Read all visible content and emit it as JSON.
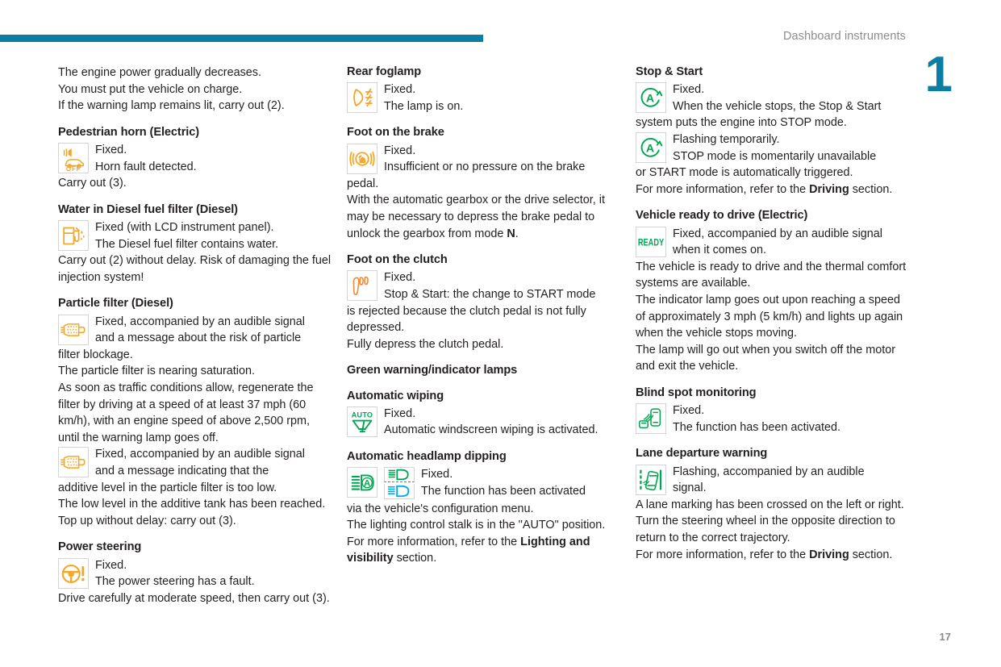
{
  "header": {
    "title": "Dashboard instruments",
    "chapter": "1",
    "page_number": "17",
    "rule_color": "#0b7ea3"
  },
  "colors": {
    "amber": "#F5A623",
    "orange": "#F08A3C",
    "green": "#00A651",
    "blue": "#00AEEF",
    "accent": "#0b7ea3",
    "grey_text": "#8a8c8f"
  },
  "columns": [
    {
      "id": "column-1",
      "blocks": [
        {
          "kind": "text",
          "name": "engine-power-line-1",
          "text": "The engine power gradually decreases."
        },
        {
          "kind": "text",
          "name": "engine-power-line-2",
          "text": "You must put the vehicle on charge."
        },
        {
          "kind": "text",
          "name": "engine-power-line-3",
          "text": "If the warning lamp remains lit, carry out (2)."
        },
        {
          "kind": "heading",
          "name": "heading-pedestrian-horn",
          "text": "Pedestrian horn (Electric)"
        },
        {
          "kind": "icon",
          "name": "icon-pedestrian-horn",
          "icon": "pedestrian-horn-off-icon",
          "lines": [
            "Fixed.",
            "Horn fault detected."
          ]
        },
        {
          "kind": "text",
          "name": "pedestrian-horn-followup",
          "text": "Carry out (3)."
        },
        {
          "kind": "heading",
          "name": "heading-water-in-diesel-fuel-filter",
          "text": "Water in Diesel fuel filter (Diesel)"
        },
        {
          "kind": "icon",
          "name": "icon-water-in-diesel-fuel-filter",
          "icon": "fuel-filter-water-icon",
          "lines": [
            "Fixed (with LCD instrument panel).",
            "The Diesel fuel filter contains water."
          ]
        },
        {
          "kind": "text",
          "name": "water-in-fuel-filter-followup",
          "text": "Carry out (2) without delay. Risk of damaging the fuel injection system!"
        },
        {
          "kind": "heading",
          "name": "heading-particle-filter",
          "text": "Particle filter (Diesel)"
        },
        {
          "kind": "icon",
          "name": "icon-particle-filter-blockage",
          "icon": "particle-filter-icon",
          "lines": [
            "Fixed, accompanied by an audible signal",
            "and a message about the risk of particle"
          ]
        },
        {
          "kind": "text",
          "name": "particle-filter-blockage-followup",
          "text": "filter blockage."
        },
        {
          "kind": "text",
          "name": "particle-filter-saturation",
          "text": "The particle filter is nearing saturation."
        },
        {
          "kind": "text",
          "name": "particle-filter-regeneration",
          "text": "As soon as traffic conditions allow, regenerate the filter by driving at a speed of at least 37 mph (60 km/h), with an engine speed of above 2,500 rpm, until the warning lamp goes off."
        },
        {
          "kind": "icon",
          "name": "icon-particle-filter-additive",
          "icon": "particle-filter-icon",
          "lines": [
            "Fixed, accompanied by an audible signal",
            "and a message indicating that the"
          ]
        },
        {
          "kind": "text",
          "name": "particle-filter-additive-followup",
          "text": "additive level in the particle filter is too low."
        },
        {
          "kind": "text",
          "name": "additive-tank-low",
          "text": "The low level in the additive tank has been reached."
        },
        {
          "kind": "text",
          "name": "additive-top-up",
          "text": "Top up without delay: carry out (3)."
        },
        {
          "kind": "heading",
          "name": "heading-power-steering",
          "text": "Power steering"
        },
        {
          "kind": "icon",
          "name": "icon-power-steering",
          "icon": "power-steering-icon",
          "lines": [
            "Fixed.",
            "The power steering has a fault."
          ]
        },
        {
          "kind": "text",
          "name": "power-steering-followup",
          "text": "Drive carefully at moderate speed, then carry out (3)."
        }
      ]
    },
    {
      "id": "column-2",
      "blocks": [
        {
          "kind": "heading",
          "name": "heading-rear-foglamp",
          "text": "Rear foglamp"
        },
        {
          "kind": "icon",
          "name": "icon-rear-foglamp",
          "icon": "rear-foglamp-icon",
          "lines": [
            "Fixed.",
            "The lamp is on."
          ]
        },
        {
          "kind": "heading",
          "name": "heading-foot-on-the-brake",
          "text": "Foot on the brake"
        },
        {
          "kind": "icon",
          "name": "icon-foot-on-the-brake",
          "icon": "foot-on-brake-icon",
          "lines": [
            "Fixed.",
            "Insufficient or no pressure on the brake"
          ]
        },
        {
          "kind": "text",
          "name": "foot-on-brake-followup",
          "text": "pedal."
        },
        {
          "kind": "rich",
          "name": "foot-on-brake-gearbox-note",
          "html": "With the automatic gearbox or the drive selector, it may be necessary to depress the brake pedal to unlock the gearbox from mode <b>N</b>."
        },
        {
          "kind": "heading",
          "name": "heading-foot-on-the-clutch",
          "text": "Foot on the clutch"
        },
        {
          "kind": "icon",
          "name": "icon-foot-on-the-clutch",
          "icon": "foot-on-clutch-icon",
          "lines": [
            "Fixed.",
            "Stop & Start: the change to START mode"
          ]
        },
        {
          "kind": "text",
          "name": "foot-on-clutch-followup",
          "text": "is rejected because the clutch pedal is not fully depressed."
        },
        {
          "kind": "text",
          "name": "foot-on-clutch-action",
          "text": "Fully depress the clutch pedal."
        },
        {
          "kind": "heading",
          "name": "heading-green-warning-lamps",
          "text": "Green warning/indicator lamps"
        },
        {
          "kind": "heading",
          "name": "heading-automatic-wiping",
          "text": "Automatic wiping"
        },
        {
          "kind": "icon",
          "name": "icon-automatic-wiping",
          "icon": "automatic-wiping-icon",
          "lines": [
            "Fixed.",
            "Automatic windscreen wiping is activated."
          ]
        },
        {
          "kind": "heading",
          "name": "heading-automatic-headlamp-dipping",
          "text": "Automatic headlamp dipping"
        },
        {
          "kind": "dualicon",
          "name": "icon-automatic-headlamp-dipping",
          "icon_left": "auto-headlamp-a-icon",
          "icon_right_top": "main-beam-green-icon",
          "icon_right_bottom": "dipped-beam-blue-icon",
          "lines": [
            "Fixed.",
            "The function has been activated"
          ]
        },
        {
          "kind": "text",
          "name": "auto-headlamp-followup",
          "text": "via the vehicle's configuration menu."
        },
        {
          "kind": "text",
          "name": "auto-headlamp-stalk",
          "text": "The lighting control stalk is in the \"AUTO\" position."
        },
        {
          "kind": "rich",
          "name": "auto-headlamp-more-info",
          "html": "For more information, refer to the <b>Lighting and visibility</b> section."
        }
      ]
    },
    {
      "id": "column-3",
      "blocks": [
        {
          "kind": "heading",
          "name": "heading-stop-and-start",
          "text": "Stop & Start"
        },
        {
          "kind": "icon",
          "name": "icon-stop-start-fixed",
          "icon": "stop-start-a-icon",
          "lines": [
            "Fixed.",
            "When the vehicle stops, the Stop & Start"
          ]
        },
        {
          "kind": "text",
          "name": "stop-start-fixed-followup",
          "text": "system puts the engine into STOP mode."
        },
        {
          "kind": "icon",
          "name": "icon-stop-start-flashing",
          "icon": "stop-start-a-icon",
          "lines": [
            "Flashing temporarily.",
            "STOP mode is momentarily unavailable"
          ]
        },
        {
          "kind": "text",
          "name": "stop-start-flashing-followup",
          "text": "or START mode is automatically triggered."
        },
        {
          "kind": "rich",
          "name": "stop-start-more-info",
          "html": "For more information, refer to the <b>Driving</b> section."
        },
        {
          "kind": "heading",
          "name": "heading-vehicle-ready-to-drive",
          "text": "Vehicle ready to drive (Electric)"
        },
        {
          "kind": "icon",
          "name": "icon-vehicle-ready",
          "icon": "ready-icon",
          "lines": [
            "Fixed, accompanied by an audible signal",
            "when it comes on."
          ]
        },
        {
          "kind": "text",
          "name": "vehicle-ready-thermal",
          "text": "The vehicle is ready to drive and the thermal comfort systems are available."
        },
        {
          "kind": "text",
          "name": "vehicle-ready-speed",
          "text": "The indicator lamp goes out upon reaching a speed of approximately 3 mph (5 km/h) and lights up again when the vehicle stops moving."
        },
        {
          "kind": "text",
          "name": "vehicle-ready-switch-off",
          "text": "The lamp will go out when you switch off the motor and exit the vehicle."
        },
        {
          "kind": "heading",
          "name": "heading-blind-spot-monitoring",
          "text": "Blind spot monitoring"
        },
        {
          "kind": "icon",
          "name": "icon-blind-spot-monitoring",
          "icon": "blind-spot-icon",
          "lines": [
            "Fixed.",
            "The function has been activated."
          ]
        },
        {
          "kind": "heading",
          "name": "heading-lane-departure-warning",
          "text": "Lane departure warning"
        },
        {
          "kind": "icon",
          "name": "icon-lane-departure-warning",
          "icon": "lane-departure-icon",
          "lines": [
            "Flashing, accompanied by an audible",
            "signal."
          ]
        },
        {
          "kind": "text",
          "name": "lane-departure-crossed",
          "text": "A lane marking has been crossed on the left or right."
        },
        {
          "kind": "text",
          "name": "lane-departure-action",
          "text": "Turn the steering wheel in the opposite direction to return to the correct trajectory."
        },
        {
          "kind": "rich",
          "name": "lane-departure-more-info",
          "html": "For more information, refer to the <b>Driving</b> section."
        }
      ]
    }
  ]
}
